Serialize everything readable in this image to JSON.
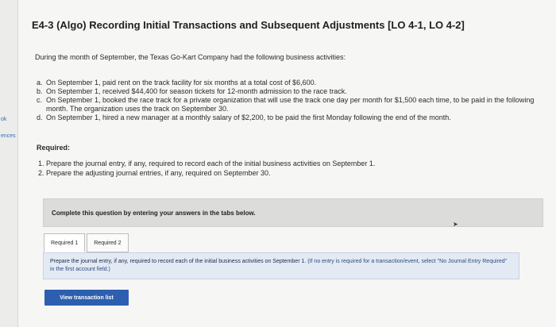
{
  "sidebar": {
    "labels": [
      "ok",
      "ences"
    ]
  },
  "header": {
    "title": "E4-3 (Algo) Recording Initial Transactions and Subsequent Adjustments [LO 4-1, LO 4-2]"
  },
  "intro": "During the month of September, the Texas Go-Kart Company had the following business activities:",
  "activities": [
    {
      "letter": "a.",
      "text": "On September 1, paid rent on the track facility for six months at a total cost of $6,600."
    },
    {
      "letter": "b.",
      "text": "On September 1, received $44,400 for season tickets for 12-month admission to the race track."
    },
    {
      "letter": "c.",
      "text": "On September 1, booked the race track for a private organization that will use the track one day per month for $1,500 each time, to be paid in the following month. The organization uses the track on September 30."
    },
    {
      "letter": "d.",
      "text": "On September 1, hired a new manager at a monthly salary of $2,200, to be paid the first Monday following the end of the month."
    }
  ],
  "required": {
    "heading": "Required:",
    "items": [
      "1. Prepare the journal entry, if any, required to record each of the initial business activities on September 1.",
      "2. Prepare the adjusting journal entries, if any, required on September 30."
    ]
  },
  "complete_box": {
    "text": "Complete this question by entering your answers in the tabs below."
  },
  "tabs": [
    {
      "label": "Required 1"
    },
    {
      "label": "Required 2"
    }
  ],
  "instructions": {
    "main": "Prepare the journal entry, if any, required to record each of the initial business activities on September 1.",
    "note": "(If no entry is required for a transaction/event, select \"No Journal Entry Required\" in the first account field.)"
  },
  "buttons": {
    "view_transaction_list": "View transaction list"
  },
  "colors": {
    "button_bg": "#2d5fb0",
    "panel_bg": "#e3eaf4",
    "complete_bg": "#dcdcda"
  }
}
